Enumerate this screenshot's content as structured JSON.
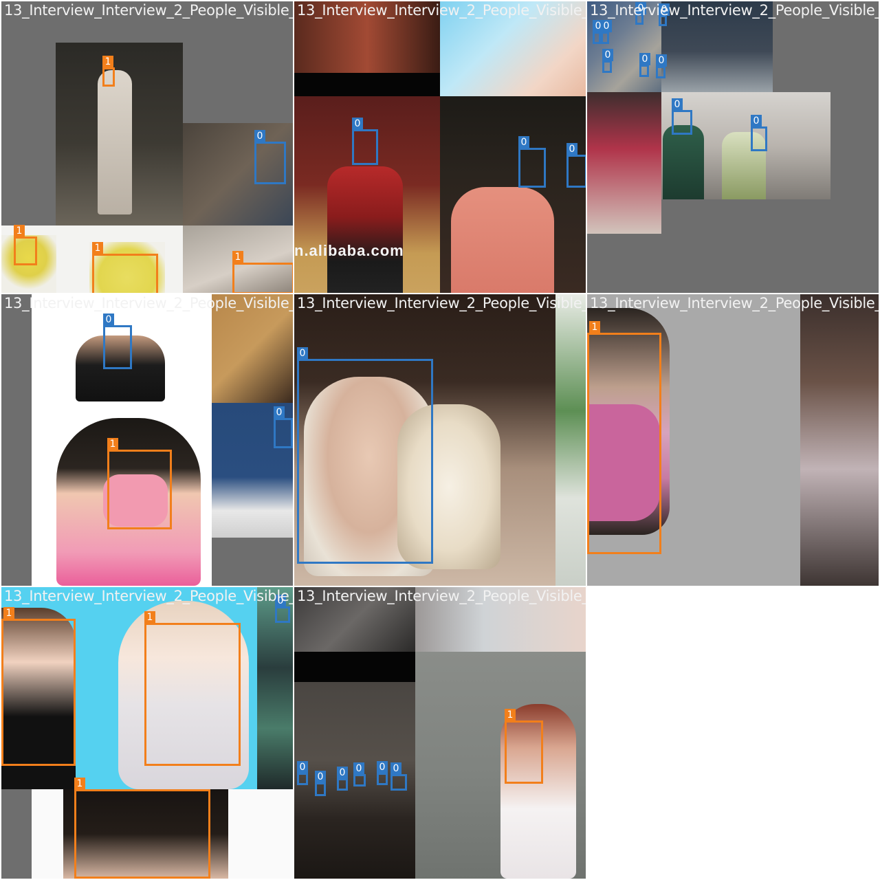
{
  "tile_title": "13_Interview_Interview_2_People_Visible_",
  "classes": {
    "c0": "0",
    "c1": "1"
  },
  "colors": {
    "class0": "#2f78c4",
    "class1": "#f27f1b",
    "padding": "#6e6e6e"
  },
  "tiles": [
    {
      "id": "tile-1",
      "title": "13_Interview_Interview_2_People_Visible_"
    },
    {
      "id": "tile-2",
      "title": "13_Interview_Interview_2_People_Visible_"
    },
    {
      "id": "tile-3",
      "title": "13_Interview_Interview_2_People_Visible_"
    },
    {
      "id": "tile-4",
      "title": "13_Interview_Interview_2_People_Visible_"
    },
    {
      "id": "tile-5",
      "title": "13_Interview_Interview_2_People_Visible_"
    },
    {
      "id": "tile-6",
      "title": "13_Interview_Interview_2_People_Visible_"
    },
    {
      "id": "tile-7",
      "title": "13_Interview_Interview_2_People_Visible_"
    },
    {
      "id": "tile-8",
      "title": "13_Interview_Interview_2_People_Visible_"
    }
  ],
  "watermark_text": "n.alibaba.com"
}
